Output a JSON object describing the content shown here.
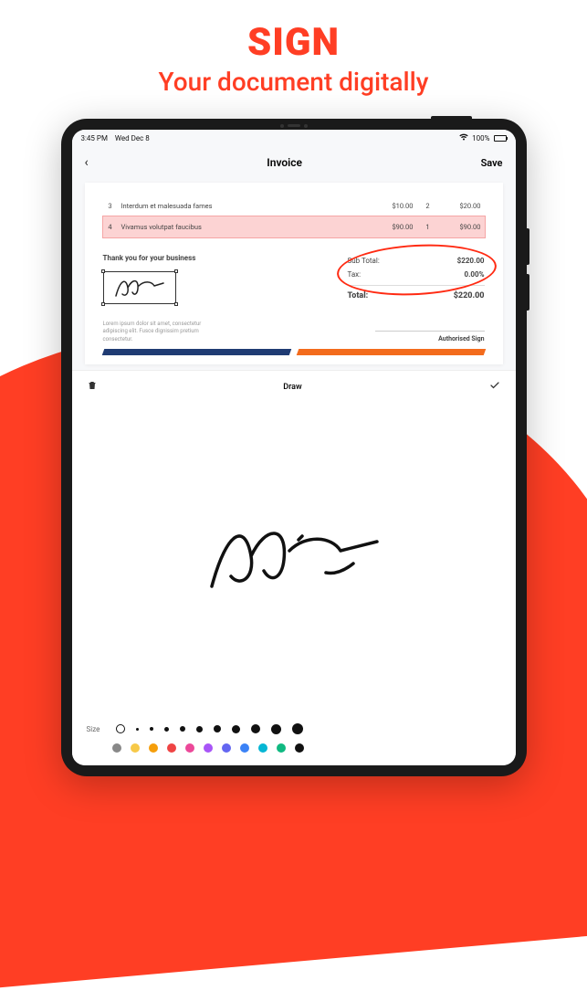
{
  "headline": {
    "title": "SIGN",
    "subtitle": "Your document digitally"
  },
  "statusbar": {
    "time": "3:45 PM",
    "date": "Wed Dec 8",
    "battery": "100%"
  },
  "nav": {
    "title": "Invoice",
    "save": "Save"
  },
  "invoice": {
    "rows": [
      {
        "n": "3",
        "desc": "Interdum et malesuada fames",
        "price": "$10.00",
        "qty": "2",
        "amount": "$20.00"
      },
      {
        "n": "4",
        "desc": "Vivamus volutpat faucibus",
        "price": "$90.00",
        "qty": "1",
        "amount": "$90.00"
      }
    ],
    "thankyou": "Thank you for your business",
    "note": "Lorem ipsum dolor sit amet, consectetur adipiscing elit. Fusce dignissim pretium consectetur.",
    "subtotal_label": "Sub Total:",
    "subtotal": "$220.00",
    "tax_label": "Tax:",
    "tax": "0.00%",
    "total_label": "Total:",
    "total": "$220.00",
    "authorised": "Authorised Sign"
  },
  "draw": {
    "label": "Draw",
    "size_label": "Size"
  },
  "colors": [
    "#888888",
    "#f7c948",
    "#f59e0b",
    "#ef4444",
    "#ec4899",
    "#a855f7",
    "#6366f1",
    "#3b82f6",
    "#06b6d4",
    "#10b981",
    "#111111"
  ]
}
